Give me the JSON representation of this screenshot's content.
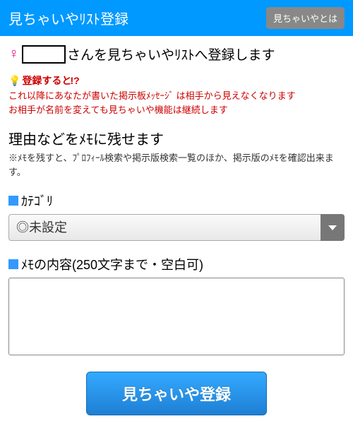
{
  "header": {
    "title": "見ちゃいやﾘｽﾄ登録",
    "info_button": "見ちゃいやとは"
  },
  "user": {
    "gender_symbol": "♀",
    "suffix_text": "さんを見ちゃいやﾘｽﾄへ登録します"
  },
  "warning": {
    "head_prefix": "登録すると",
    "head_mark": "!?",
    "bulb": "💡",
    "line1": "これ以降にあなたが書いた掲示板ﾒｯｾｰｼﾞ は相手から見えなくなります",
    "line2": "お相手が名前を変えても見ちゃいや機能は継続します"
  },
  "memo": {
    "title": "理由などをﾒﾓに残せます",
    "note": "※ﾒﾓを残すと、ﾌﾟﾛﾌｨｰﾙ検索や掲示版検索一覧のほか、掲示版のﾒﾓを確認出来ます。"
  },
  "category": {
    "label": "ｶﾃｺﾞﾘ",
    "selected": "◎未設定"
  },
  "memo_content": {
    "label": "ﾒﾓの内容(250文字まで・空白可)",
    "value": ""
  },
  "submit": {
    "label": "見ちゃいや登録"
  }
}
